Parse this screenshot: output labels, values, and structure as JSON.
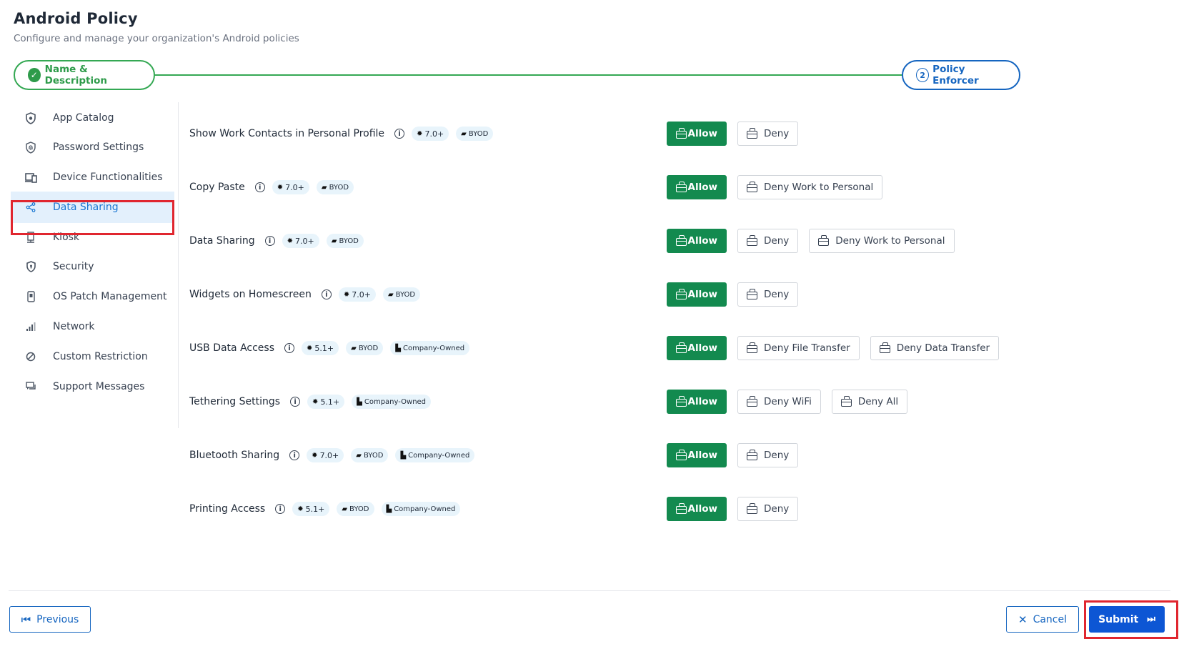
{
  "header": {
    "title": "Android Policy",
    "subtitle": "Configure and manage your organization's Android policies"
  },
  "stepper": {
    "step1": {
      "label": "Name & Description",
      "icon": "check-circle-icon"
    },
    "step2": {
      "number": "2",
      "label": "Policy Enforcer"
    }
  },
  "sidebar": {
    "items": [
      {
        "label": "App Catalog",
        "icon": "shield-star-icon"
      },
      {
        "label": "Password Settings",
        "icon": "fingerprint-shield-icon"
      },
      {
        "label": "Device Functionalities",
        "icon": "devices-icon"
      },
      {
        "label": "Data Sharing",
        "icon": "share-icon",
        "active": true
      },
      {
        "label": "Kiosk",
        "icon": "kiosk-icon"
      },
      {
        "label": "Security",
        "icon": "shield-icon"
      },
      {
        "label": "OS Patch Management",
        "icon": "phone-patch-icon"
      },
      {
        "label": "Network",
        "icon": "signal-icon"
      },
      {
        "label": "Custom Restriction",
        "icon": "block-icon"
      },
      {
        "label": "Support Messages",
        "icon": "chat-icon"
      }
    ]
  },
  "rows": [
    {
      "label": "Show Work Contacts in Personal Profile",
      "version": "7.0+",
      "tags": [
        "BYOD"
      ],
      "options": [
        "Allow",
        "Deny"
      ]
    },
    {
      "label": "Copy Paste",
      "version": "7.0+",
      "tags": [
        "BYOD"
      ],
      "options": [
        "Allow",
        "Deny Work to Personal"
      ]
    },
    {
      "label": "Data Sharing",
      "version": "7.0+",
      "tags": [
        "BYOD"
      ],
      "options": [
        "Allow",
        "Deny",
        "Deny Work to Personal"
      ]
    },
    {
      "label": "Widgets on Homescreen",
      "version": "7.0+",
      "tags": [
        "BYOD"
      ],
      "options": [
        "Allow",
        "Deny"
      ]
    },
    {
      "label": "USB Data Access",
      "version": "5.1+",
      "tags": [
        "BYOD",
        "Company-Owned"
      ],
      "options": [
        "Allow",
        "Deny File Transfer",
        "Deny Data Transfer"
      ]
    },
    {
      "label": "Tethering Settings",
      "version": "5.1+",
      "tags": [
        "Company-Owned"
      ],
      "options": [
        "Allow",
        "Deny WiFi",
        "Deny All"
      ]
    },
    {
      "label": "Bluetooth Sharing",
      "version": "7.0+",
      "tags": [
        "BYOD",
        "Company-Owned"
      ],
      "options": [
        "Allow",
        "Deny"
      ]
    },
    {
      "label": "Printing Access",
      "version": "5.1+",
      "tags": [
        "BYOD",
        "Company-Owned"
      ],
      "options": [
        "Allow",
        "Deny"
      ]
    }
  ],
  "footer": {
    "previous_label": "Previous",
    "cancel_label": "Cancel",
    "submit_label": "Submit"
  },
  "colors": {
    "accent_blue": "#1565c0",
    "allow_green": "#138a4f",
    "step_green": "#34a853",
    "highlight_red": "#e0262f",
    "active_bg": "#e3f0fc"
  }
}
